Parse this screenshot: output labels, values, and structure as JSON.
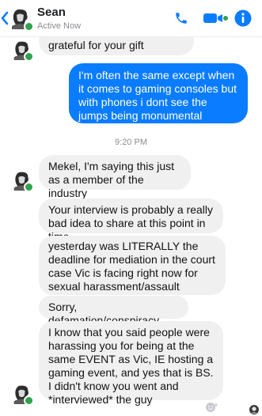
{
  "header": {
    "contact_name": "Sean",
    "status": "Active Now",
    "icons": [
      "back-arrow-icon",
      "phone-icon",
      "video-camera-icon",
      "info-icon"
    ],
    "accent_color": "#0a7cff",
    "online_color": "#31a24c"
  },
  "thread": {
    "messages": [
      {
        "from": "contact",
        "text": "grateful for your gift"
      },
      {
        "from": "me",
        "text": "I'm often the same except when it comes to gaming consoles but with phones i dont see the jumps being monumental anymore."
      },
      {
        "from": "contact",
        "text": "Mekel, I'm saying this just as a member of the industry"
      },
      {
        "from": "contact",
        "text": "Your interview is probably a really bad idea to share at this point in time"
      },
      {
        "from": "contact",
        "text": "yesterday was LITERALLY the deadline for mediation in the court case Vic is facing right now for sexual harassment/assault charges"
      },
      {
        "from": "contact",
        "text": "Sorry, defamation/conspiracy"
      },
      {
        "from": "contact",
        "text": "I know that you said people were harassing you for being at the same EVENT as Vic, IE hosting a gaming event, and yes that is BS. I didn't know you went and *interviewed* the guy"
      }
    ],
    "timestamp": "9:20 PM"
  }
}
